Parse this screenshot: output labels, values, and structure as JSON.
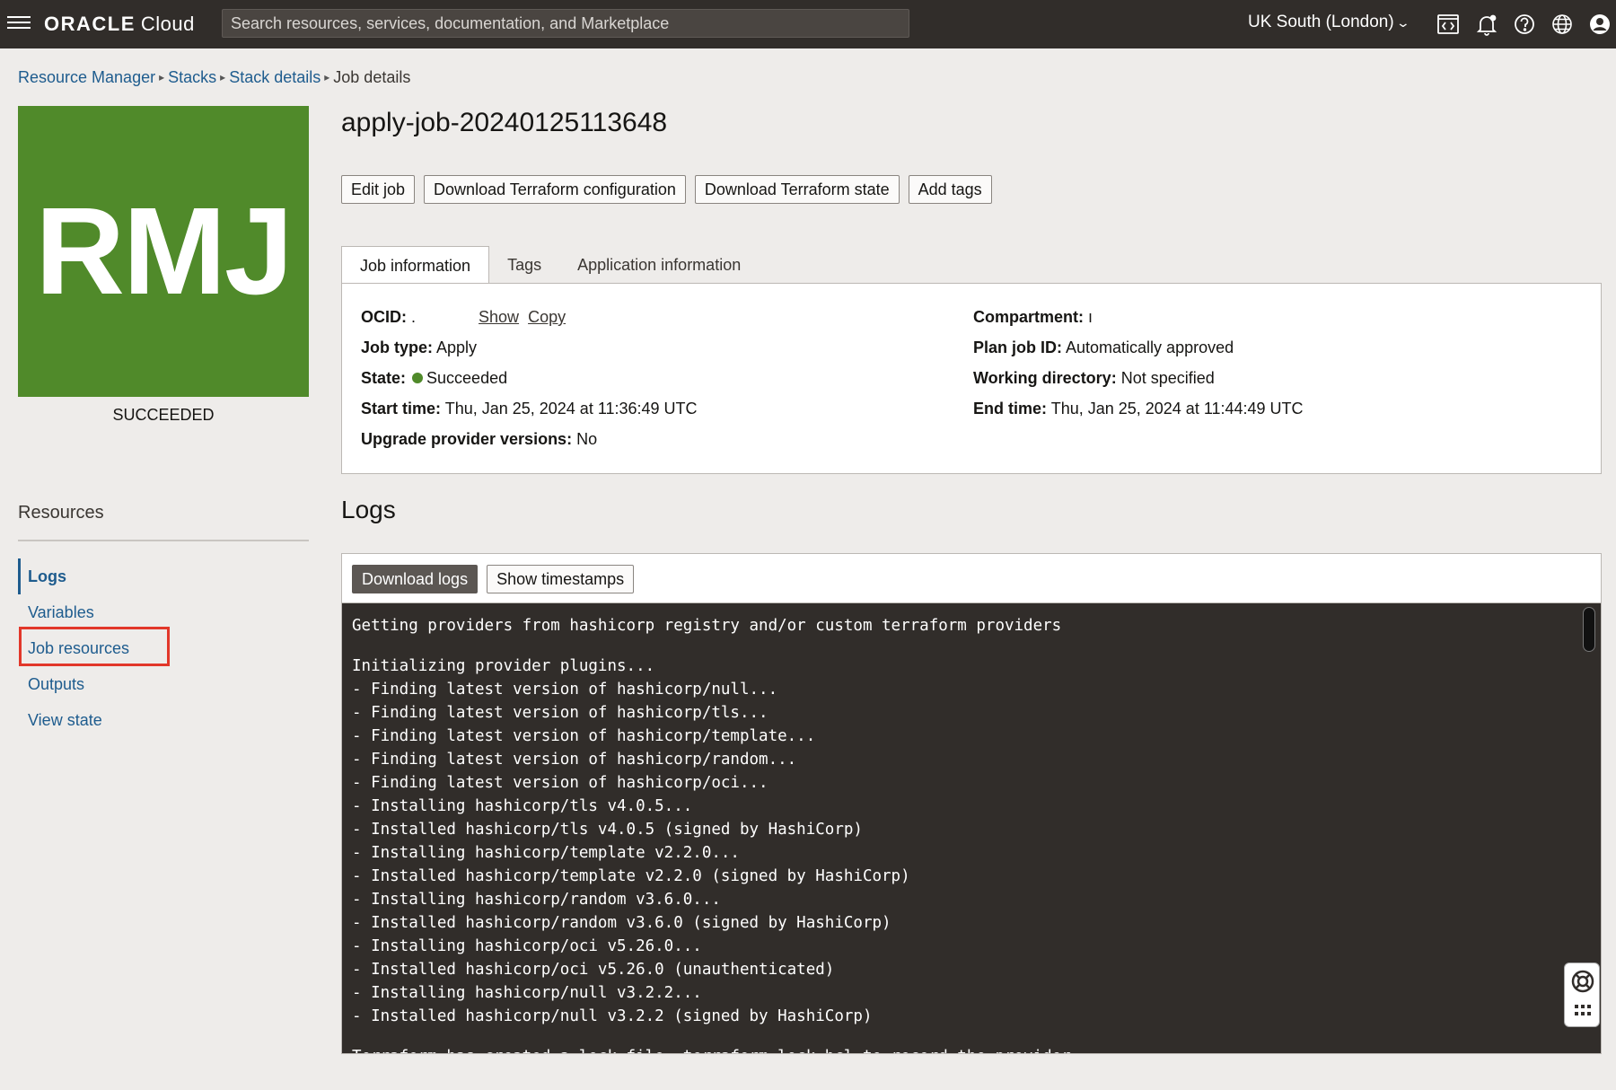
{
  "topbar": {
    "logo_brand": "ORACLE",
    "logo_product": "Cloud",
    "search_placeholder": "Search resources, services, documentation, and Marketplace",
    "region": "UK South (London)",
    "icons": [
      "menu-icon",
      "code-editor-icon",
      "bell-icon",
      "help-icon",
      "globe-icon",
      "user-icon"
    ]
  },
  "breadcrumb": {
    "items": [
      "Resource Manager",
      "Stacks",
      "Stack details"
    ],
    "current": "Job details"
  },
  "badge": {
    "initials": "RMJ",
    "state": "SUCCEEDED",
    "color": "#508a2a"
  },
  "resources": {
    "title": "Resources",
    "items": [
      "Logs",
      "Variables",
      "Job resources",
      "Outputs",
      "View state"
    ],
    "active": "Logs",
    "highlighted": "Job resources"
  },
  "job": {
    "title": "apply-job-20240125113648",
    "actions": [
      "Edit job",
      "Download Terraform configuration",
      "Download Terraform state",
      "Add tags"
    ]
  },
  "tabs": [
    "Job information",
    "Tags",
    "Application information"
  ],
  "info": {
    "ocid_label": "OCID:",
    "ocid_value": ".",
    "ocid_show": "Show",
    "ocid_copy": "Copy",
    "job_type_label": "Job type:",
    "job_type_value": "Apply",
    "state_label": "State:",
    "state_value": "Succeeded",
    "start_time_label": "Start time:",
    "start_time_value": "Thu, Jan 25, 2024 at 11:36:49 UTC",
    "upgrade_label": "Upgrade provider versions:",
    "upgrade_value": "No",
    "compartment_label": "Compartment:",
    "compartment_value": "ı",
    "plan_job_label": "Plan job ID:",
    "plan_job_value": "Automatically approved",
    "working_dir_label": "Working directory:",
    "working_dir_value": "Not specified",
    "end_time_label": "End time:",
    "end_time_value": "Thu, Jan 25, 2024 at 11:44:49 UTC"
  },
  "logs": {
    "heading": "Logs",
    "download_label": "Download logs",
    "timestamps_label": "Show timestamps",
    "lines": [
      "Getting providers from hashicorp registry and/or custom terraform providers",
      "Initializing provider plugins...",
      "- Finding latest version of hashicorp/null...",
      "- Finding latest version of hashicorp/tls...",
      "- Finding latest version of hashicorp/template...",
      "- Finding latest version of hashicorp/random...",
      "- Finding latest version of hashicorp/oci...",
      "- Installing hashicorp/tls v4.0.5...",
      "- Installed hashicorp/tls v4.0.5 (signed by HashiCorp)",
      "- Installing hashicorp/template v2.2.0...",
      "- Installed hashicorp/template v2.2.0 (signed by HashiCorp)",
      "- Installing hashicorp/random v3.6.0...",
      "- Installed hashicorp/random v3.6.0 (signed by HashiCorp)",
      "- Installing hashicorp/oci v5.26.0...",
      "- Installed hashicorp/oci v5.26.0 (unauthenticated)",
      "- Installing hashicorp/null v3.2.2...",
      "- Installed hashicorp/null v3.2.2 (signed by HashiCorp)",
      "Terraform has created a lock file .terraform.lock.hcl to record the provider"
    ]
  },
  "colors": {
    "topbar": "#312d2a",
    "link": "#1e5c8e",
    "success": "#508a2a",
    "highlight": "#e2372a",
    "log_bg": "#312d2a"
  }
}
